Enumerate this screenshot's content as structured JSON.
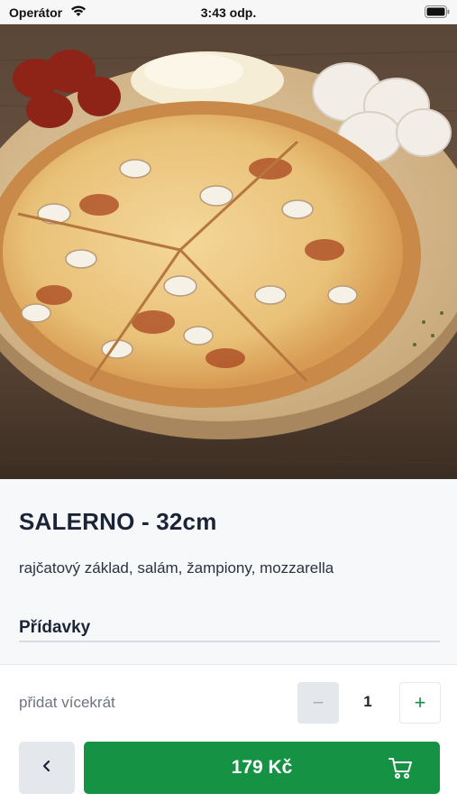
{
  "status_bar": {
    "carrier": "Operátor",
    "time": "3:43 odp."
  },
  "product": {
    "image_icon": "pizza-photo",
    "name": "SALERNO - 32cm",
    "description": "rajčatový základ, salám, žampiony, mozzarella",
    "extras_heading": "Přídavky"
  },
  "quantity": {
    "label": "přidat vícekrát",
    "minus": "−",
    "value": "1",
    "plus": "+"
  },
  "actions": {
    "back_icon": "chevron-left-icon",
    "price_label": "179 Kč",
    "cart_icon": "cart-icon"
  },
  "colors": {
    "accent": "#169244",
    "text": "#1b2436",
    "muted": "#6d7482",
    "disabled_bg": "#e4e7ec"
  }
}
